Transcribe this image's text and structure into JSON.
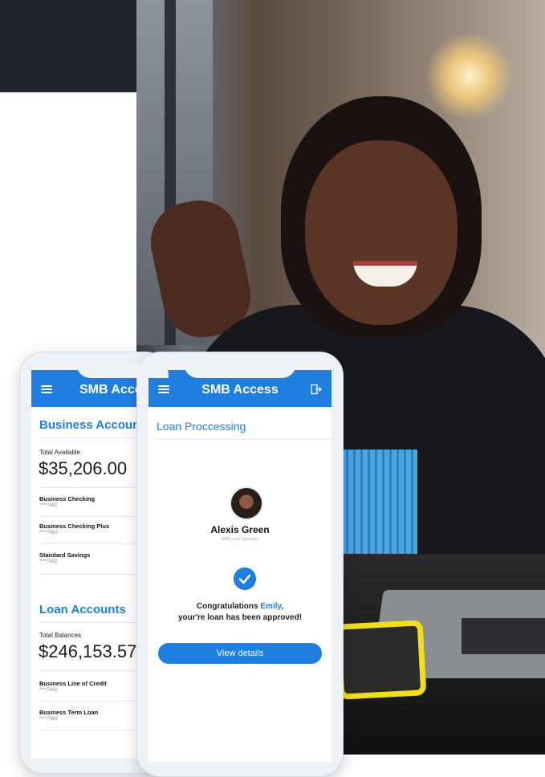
{
  "colors": {
    "accent": "#1f7fdf",
    "banner": "#1f232c"
  },
  "phone_back": {
    "app_title": "SMB Access",
    "section_business": "Business Accounts",
    "total_available_label": "Total Available",
    "total_available_value": "$35,206.00",
    "accounts": [
      {
        "name": "Business Checking",
        "number": "****7492"
      },
      {
        "name": "Business Checking Plus",
        "number": "****7492"
      },
      {
        "name": "Standard Savings",
        "number": "****7492"
      }
    ],
    "section_loans": "Loan Accounts",
    "total_balances_label": "Total Balances",
    "total_balances_value": "$246,153.57",
    "loans": [
      {
        "name": "Business Line of Credit",
        "number": "****7492"
      },
      {
        "name": "Business Term Loan",
        "number": "****7492"
      }
    ]
  },
  "phone_front": {
    "app_title": "SMB Access",
    "heading": "Loan Proccessing",
    "contact_name": "Alexis Green",
    "contact_role": "SMB Loan Specialist",
    "message_line1_prefix": "Congratulations ",
    "message_name": "Emily",
    "message_line1_suffix": ",",
    "message_line2": "your're loan has been approved!",
    "button_label": "View details"
  }
}
